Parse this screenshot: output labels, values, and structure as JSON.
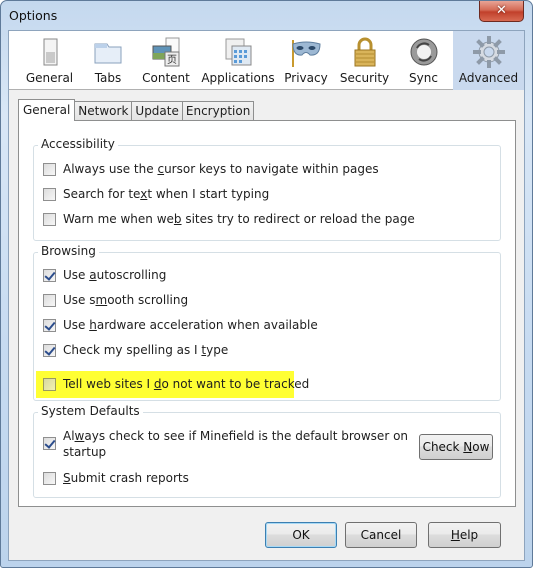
{
  "window": {
    "title": "Options",
    "close_icon": "close-x-icon"
  },
  "toolbar": {
    "items": [
      {
        "label": "General",
        "icon": "switch-icon",
        "active": false
      },
      {
        "label": "Tabs",
        "icon": "folder-tab-icon",
        "active": false
      },
      {
        "label": "Content",
        "icon": "content-page-icon",
        "active": false
      },
      {
        "label": "Applications",
        "icon": "applications-window-icon",
        "active": false
      },
      {
        "label": "Privacy",
        "icon": "mask-icon",
        "active": false
      },
      {
        "label": "Security",
        "icon": "padlock-icon",
        "active": false
      },
      {
        "label": "Sync",
        "icon": "sync-arrows-icon",
        "active": false
      },
      {
        "label": "Advanced",
        "icon": "gear-icon",
        "active": true
      }
    ]
  },
  "tabs": [
    {
      "label": "General",
      "active": true
    },
    {
      "label": "Network",
      "active": false
    },
    {
      "label": "Update",
      "active": false
    },
    {
      "label": "Encryption",
      "active": false
    }
  ],
  "groups": {
    "accessibility": {
      "legend": "Accessibility",
      "items": [
        {
          "pre": "Always use the ",
          "key": "c",
          "post": "ursor keys to navigate within pages",
          "checked": false
        },
        {
          "pre": "Search for te",
          "key": "x",
          "post": "t when I start typing",
          "checked": false
        },
        {
          "pre": "Warn me when we",
          "key": "b",
          "post": " sites try to redirect or reload the page",
          "checked": false
        }
      ]
    },
    "browsing": {
      "legend": "Browsing",
      "items": [
        {
          "pre": "Use ",
          "key": "a",
          "post": "utoscrolling",
          "checked": true
        },
        {
          "pre": "Use s",
          "key": "m",
          "post": "ooth scrolling",
          "checked": false
        },
        {
          "pre": "Use ",
          "key": "h",
          "post": "ardware acceleration when available",
          "checked": true
        },
        {
          "pre": "Check my spelling as I ",
          "key": "t",
          "post": "ype",
          "checked": true
        },
        {
          "pre": "Tell web sites I ",
          "key": "d",
          "post": "o not want to be tracked",
          "checked": false,
          "highlighted": true
        }
      ]
    },
    "system_defaults": {
      "legend": "System Defaults",
      "items": [
        {
          "pre": "Al",
          "key": "w",
          "post": "ays check to see if Minefield is the default browser on",
          "line2": "startup",
          "checked": true
        },
        {
          "pre": "",
          "key": "S",
          "post": "ubmit crash reports",
          "checked": false
        }
      ],
      "check_now": {
        "pre": "Check ",
        "key": "N",
        "post": "ow"
      }
    }
  },
  "buttons": {
    "ok": "OK",
    "cancel": "Cancel",
    "help": {
      "pre": "",
      "key": "H",
      "post": "elp"
    }
  },
  "highlight_color": "#ffff33"
}
